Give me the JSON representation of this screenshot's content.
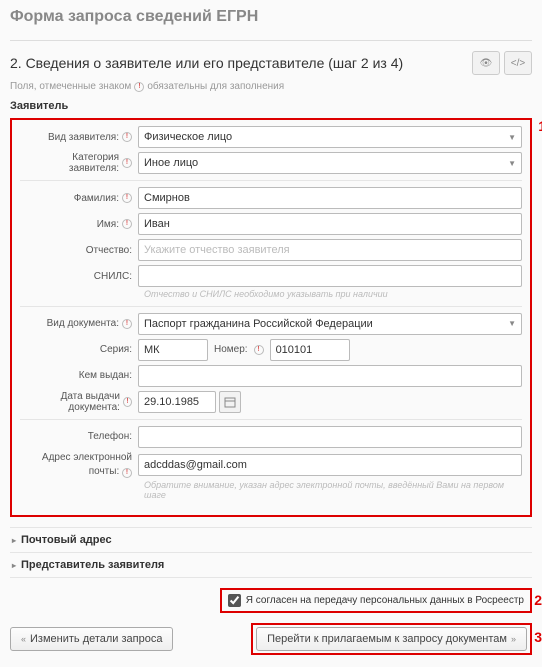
{
  "page_title": "Форма запроса сведений ЕГРН",
  "step_title": "2. Сведения о заявителе или его представителе (шаг 2 из 4)",
  "required_hint": "Поля, отмеченные знаком",
  "required_hint2": "обязательны для заполнения",
  "section_applicant": "Заявитель",
  "markers": {
    "m1": "1",
    "m2": "2",
    "m3": "3"
  },
  "labels": {
    "applicant_type": "Вид заявителя:",
    "applicant_category": "Категория заявителя:",
    "surname": "Фамилия:",
    "name": "Имя:",
    "patronymic": "Отчество:",
    "snils": "СНИЛС:",
    "doc_type": "Вид документа:",
    "series": "Серия:",
    "number": "Номер:",
    "issued_by": "Кем выдан:",
    "issue_date": "Дата выдачи документа:",
    "phone": "Телефон:",
    "email1": "Адрес электронной",
    "email2": "почты:"
  },
  "values": {
    "applicant_type": "Физическое лицо",
    "applicant_category": "Иное лицо",
    "surname": "Смирнов",
    "name": "Иван",
    "patronymic_ph": "Укажите отчество заявителя",
    "doc_type": "Паспорт гражданина Российской Федерации",
    "series": "МК",
    "number": "010101",
    "issue_date": "29.10.1985",
    "email": "adcddas@gmail.com"
  },
  "hints": {
    "snils": "Отчество и СНИЛС необходимо указывать при наличии",
    "email": "Обратите внимание, указан адрес электронной почты, введённый Вами на первом шаге"
  },
  "accordions": {
    "postal": "Почтовый адрес",
    "representative": "Представитель заявителя"
  },
  "consent": "Я согласен на передачу персональных данных в Росреестр",
  "buttons": {
    "back": "Изменить детали запроса",
    "next": "Перейти к прилагаемым к запросу документам"
  }
}
